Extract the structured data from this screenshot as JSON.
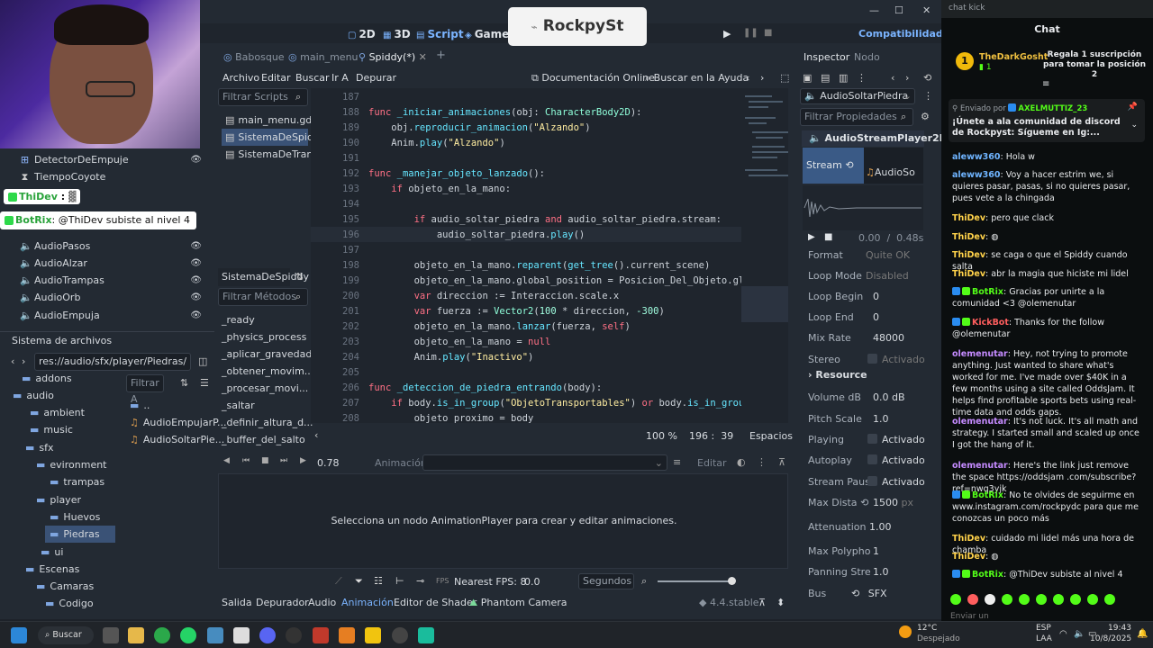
{
  "window": {
    "minimize": "—",
    "maximize": "☐",
    "close": "✕"
  },
  "modes": [
    {
      "icon": "▢",
      "label": "2D"
    },
    {
      "icon": "▦",
      "label": "3D"
    },
    {
      "icon": "▤",
      "label": "Script"
    },
    {
      "icon": "◈",
      "label": "Game"
    }
  ],
  "compat": "Compatibilidad",
  "brand_overlay": "RockpySt",
  "scene_tree": {
    "items": [
      "DetectorDeEmpuje",
      "TiempoCoyote",
      "AudioPasos",
      "AudioAlzar",
      "AudioTrampas",
      "AudioOrb",
      "AudioEmpuja"
    ],
    "overlay1_user": "ThiDev",
    "overlay1_sep": ":",
    "overlay2_user": "BotRix",
    "overlay2_text": ": @ThiDev subiste al nivel 4"
  },
  "filesystem": {
    "title": "Sistema de archivos",
    "path": "res://audio/sfx/player/Piedras/",
    "filter": "Filtrar A",
    "tree": [
      "addons",
      "audio",
      "ambient",
      "music",
      "sfx",
      "evironment",
      "trampas",
      "player",
      "Huevos",
      "Piedras",
      "ui",
      "Escenas",
      "Camaras",
      "Codigo"
    ],
    "files": [
      "..",
      "AudioEmpujarP...",
      "AudioSoltarPie..."
    ]
  },
  "tabs": [
    "Babosque",
    "main_menu",
    "Spiddy(*)"
  ],
  "menu": [
    "Archivo",
    "Editar",
    "Buscar",
    "Ir A",
    "Depurar"
  ],
  "doc_link": "Documentación Online",
  "help_search": "Buscar en la Ayuda",
  "scripts": {
    "filter": "Filtrar Scripts",
    "items": [
      "main_menu.gd",
      "SistemaDeSpidd...",
      "SistemaDeTrans..."
    ],
    "current": "SistemaDeSpiddy",
    "methods_filter": "Filtrar Métodos",
    "methods": [
      "_ready",
      "_physics_process",
      "_aplicar_gravedad",
      "_obtener_movim...",
      "_procesar_movi...",
      "_saltar",
      "_definir_altura_d...",
      "_buffer_del_salto"
    ]
  },
  "code": {
    "lines": [
      "187",
      "188",
      "189",
      "190",
      "191",
      "192",
      "193",
      "194",
      "195",
      "196",
      "197",
      "198",
      "199",
      "200",
      "201",
      "202",
      "203",
      "204",
      "205",
      "206",
      "207",
      "208"
    ]
  },
  "code_status": {
    "zoom": "100 %",
    "pos": "196 :  39",
    "indent": "Espacios"
  },
  "anim": {
    "time": "0.78",
    "label": "Animación",
    "edit": "Editar",
    "message": "Selecciona un nodo AnimationPlayer para crear y editar animaciones.",
    "fps_label": "FPS",
    "snap": "Nearest FPS: 8",
    "value": "0.0",
    "unit": "Segundos"
  },
  "bottom_tabs": [
    "Salida",
    "Depurador",
    "Audio",
    "Animación",
    "Editor de Shader",
    "Phantom Camera"
  ],
  "version": "4.4.stable",
  "inspector": {
    "tabs": [
      "Inspector",
      "Nodo"
    ],
    "node": "AudioSoltarPiedra",
    "filter": "Filtrar Propiedades",
    "class": "AudioStreamPlayer2D",
    "stream_label": "Stream",
    "stream_value": "AudioSo",
    "time": "0.00  /  0.48s",
    "props": [
      {
        "k": "Format",
        "v": "Quite OK"
      },
      {
        "k": "Loop Mode",
        "v": "Disabled"
      },
      {
        "k": "Loop Begin",
        "v": "0"
      },
      {
        "k": "Loop End",
        "v": "0"
      },
      {
        "k": "Mix Rate",
        "v": "48000"
      },
      {
        "k": "Stereo",
        "v": "Activado"
      }
    ],
    "resource": "Resource",
    "props2": [
      {
        "k": "Volume dB",
        "v": "0.0 dB"
      },
      {
        "k": "Pitch Scale",
        "v": "1.0"
      },
      {
        "k": "Playing",
        "v": "Activado"
      },
      {
        "k": "Autoplay",
        "v": "Activado"
      },
      {
        "k": "Stream Paus",
        "v": "Activado"
      },
      {
        "k": "Max Dista",
        "v": "1500"
      },
      {
        "k": "Attenuation",
        "v": "1.00"
      },
      {
        "k": "Max Polypho",
        "v": "1"
      },
      {
        "k": "Panning Stre",
        "v": "1.0"
      },
      {
        "k": "Bus",
        "v": "SFX"
      }
    ],
    "px_unit": "px"
  },
  "chat": {
    "tab": "chat kick",
    "title": "Chat",
    "gift_user": "TheDarkGosht",
    "gift_count": "1",
    "gift_text": "Regala 1 suscripción para tomar la posición 2",
    "pinned_by": "Enviado por",
    "pinned_user": "AXELMUTTIZ_23",
    "pinned_text": "¡Únete a ala comunidad de discord de Rockpyst: Sígueme en Ig:...",
    "messages": [
      {
        "u": "aleww360",
        "t": ": Hola w"
      },
      {
        "u": "aleww360",
        "t": ": Voy a hacer estrim we, si quieres pasar, pasas, si no quieres pasar, pues vete a la chingada"
      },
      {
        "u": "ThiDev",
        "t": ": pero que clack"
      },
      {
        "u": "ThiDev",
        "t": ":"
      },
      {
        "u": "ThiDev",
        "t": ": se caga o que el Spiddy cuando salta"
      },
      {
        "u": "ThiDev",
        "t": ": abr la magia que hiciste mi lidel"
      },
      {
        "u": "BotRix",
        "t": ": Gracias por unirte a la comunidad <3 @olemenutar"
      },
      {
        "u": "KickBot",
        "t": ": Thanks for the follow @olemenutar"
      },
      {
        "u": "olemenutar",
        "t": ": Hey, not trying to promote anything. Just wanted to share what's worked for me. I've made over $40K in a few months using a site called OddsJam. It helps find profitable sports bets using real-time data and odds gaps."
      },
      {
        "u": "olemenutar",
        "t": ": It's not luck. It's all math and strategy. I started small and scaled up once I got the hang of it."
      },
      {
        "u": "olemenutar",
        "t": ": Here's the link just remove the space https://oddsjam .com/subscribe?ref=nwq3yjk"
      },
      {
        "u": "BotRix",
        "t": ": No te olvides de seguirme en www.instagram.com/rockpydc para que me conozcas un poco más"
      },
      {
        "u": "ThiDev",
        "t": ": cuidado mi lidel más una hora de chamba"
      },
      {
        "u": "ThiDev",
        "t": ":"
      },
      {
        "u": "BotRix",
        "t": ": @ThiDev subiste al nivel 4"
      }
    ],
    "input": "Enviar un"
  },
  "taskbar": {
    "search": "Buscar",
    "weather_temp": "12°C",
    "weather_desc": "Despejado",
    "lang": "ESP",
    "lang2": "LAA",
    "time": "19:43",
    "date": "10/8/2025"
  }
}
